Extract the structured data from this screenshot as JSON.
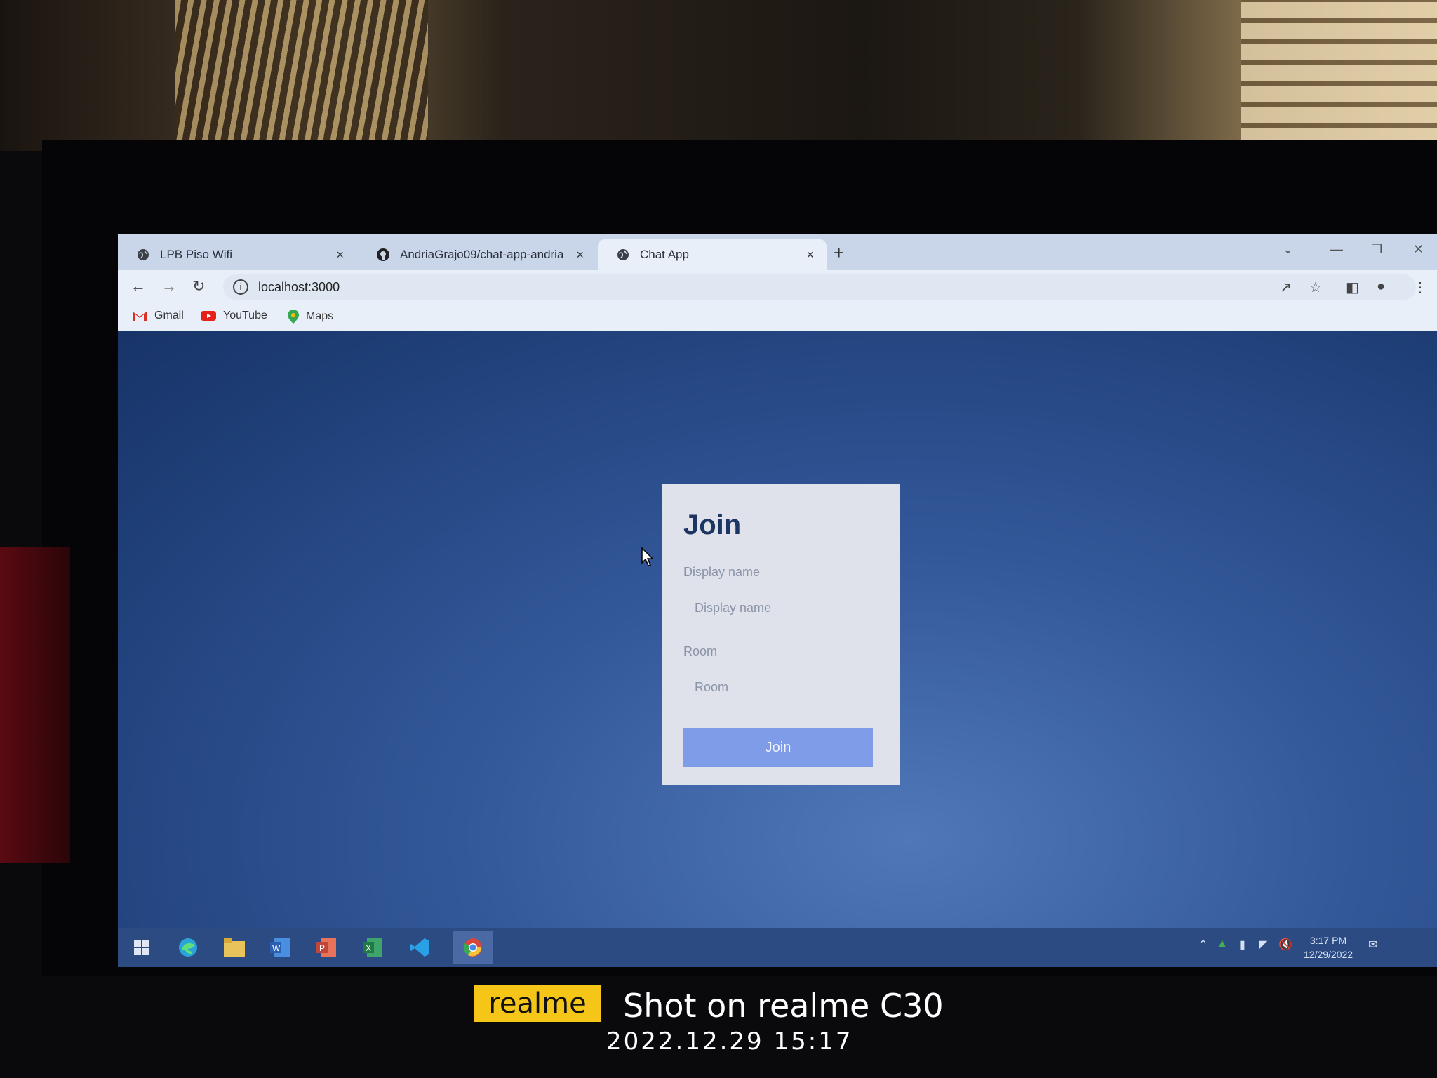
{
  "browser": {
    "tabs": [
      {
        "label": "LPB Piso Wifi",
        "icon": "globe-icon",
        "close": "×"
      },
      {
        "label": "AndriaGrajo09/chat-app-andria",
        "icon": "github-icon",
        "close": "×"
      },
      {
        "label": "Chat App",
        "icon": "globe-icon",
        "close": "×",
        "active": true
      }
    ],
    "new_tab": "+",
    "url": "localhost:3000",
    "bookmarks": [
      {
        "label": "Gmail",
        "icon": "gmail-icon"
      },
      {
        "label": "YouTube",
        "icon": "youtube-icon"
      },
      {
        "label": "Maps",
        "icon": "maps-icon"
      }
    ]
  },
  "join_form": {
    "title": "Join",
    "display_name_label": "Display name",
    "display_name_placeholder": "Display name",
    "room_label": "Room",
    "room_placeholder": "Room",
    "button_label": "Join",
    "button_color": "#7e9ce8"
  },
  "taskbar": {
    "apps": [
      "windows-start-icon",
      "edge-icon",
      "file-explorer-icon",
      "word-icon",
      "powerpoint-icon",
      "excel-icon",
      "vscode-icon",
      "chrome-icon"
    ],
    "time": "3:17 PM",
    "date": "12/29/2022"
  },
  "watermark": {
    "brand": "realme",
    "shot_text": "Shot on realme C30",
    "timestamp": "2022.12.29  15:17"
  }
}
